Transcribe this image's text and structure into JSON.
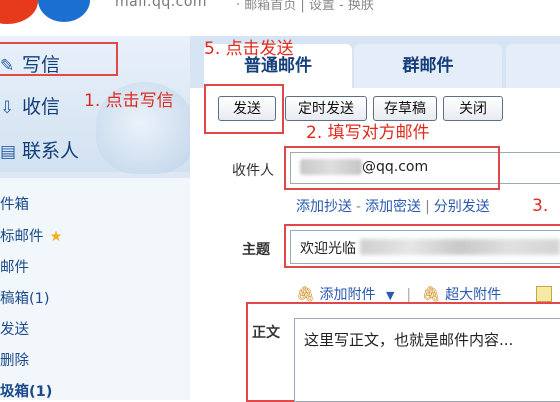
{
  "header": {
    "logo_text": "mail.qq.com",
    "top_links": "· 邮箱首页 | 设置 - 换肤"
  },
  "sidebar": {
    "compose": "写信",
    "inbox": "收信",
    "contacts": "联系人",
    "folders": [
      "件箱",
      "标邮件",
      "邮件",
      "稿箱(1)",
      "发送",
      "删除",
      "圾箱(1)"
    ]
  },
  "tabs": [
    "普通邮件",
    "群邮件"
  ],
  "toolbar": {
    "send": "发送",
    "timed_send": "定时发送",
    "save_draft": "存草稿",
    "close": "关闭"
  },
  "form": {
    "to_label": "收件人",
    "to_value": "@qq.com",
    "cc_links": [
      "添加抄送",
      "添加密送",
      "分别发送"
    ],
    "subject_label": "主题",
    "subject_value": "欢迎光临",
    "attach_links": [
      "添加附件",
      "超大附件"
    ],
    "body_label": "正文",
    "body_value": "这里写正文，也就是邮件内容..."
  },
  "annotations": {
    "step1": "1. 点击写信",
    "step2": "2. 填写对方邮件",
    "step3": "3.",
    "step5": "5. 点击发送"
  },
  "colors": {
    "annotation_red": "#e0291d",
    "sidebar_bg": "#dde8f4",
    "link_blue": "#2a5ab0"
  }
}
